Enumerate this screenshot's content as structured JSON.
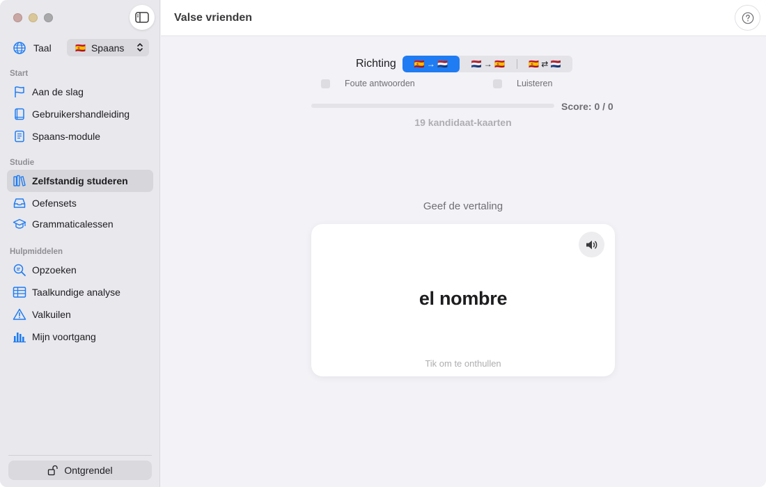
{
  "window": {
    "traffic_lights": [
      "close",
      "minimize",
      "zoom"
    ]
  },
  "sidebar": {
    "toggle_icon": "sidebar-toggle-icon",
    "language": {
      "label": "Taal",
      "icon": "globe-icon",
      "flag": "🇪🇸",
      "selected": "Spaans"
    },
    "sections": [
      {
        "title": "Start",
        "items": [
          {
            "label": "Aan de slag",
            "icon": "flag-icon"
          },
          {
            "label": "Gebruikershandleiding",
            "icon": "book-icon"
          },
          {
            "label": "Spaans-module",
            "icon": "document-icon"
          }
        ]
      },
      {
        "title": "Studie",
        "items": [
          {
            "label": "Zelfstandig studeren",
            "icon": "books-icon",
            "active": true
          },
          {
            "label": "Oefensets",
            "icon": "tray-icon"
          },
          {
            "label": "Grammaticalessen",
            "icon": "graduation-cap-icon"
          }
        ]
      },
      {
        "title": "Hulpmiddelen",
        "items": [
          {
            "label": "Opzoeken",
            "icon": "magnifier-icon"
          },
          {
            "label": "Taalkundige analyse",
            "icon": "table-icon"
          },
          {
            "label": "Valkuilen",
            "icon": "warning-icon"
          },
          {
            "label": "Mijn voortgang",
            "icon": "bar-chart-icon"
          }
        ]
      }
    ],
    "unlock_label": "Ontgrendel"
  },
  "header": {
    "title": "Valse vrienden",
    "help_icon": "question-mark-icon"
  },
  "controls": {
    "direction_label": "Richting",
    "direction_options": [
      "🇪🇸 → 🇳🇱",
      "🇳🇱 → 🇪🇸",
      "🇪🇸 ⇄ 🇳🇱"
    ],
    "direction_selected": 0,
    "wrong_answers_label": "Foute antwoorden",
    "wrong_answers_checked": false,
    "listen_label": "Luisteren",
    "listen_checked": false,
    "progress": 0,
    "score": "Score: 0 / 0",
    "candidates": "19 kandidaat-kaarten"
  },
  "card": {
    "prompt": "Geef de vertaling",
    "word": "el nombre",
    "hint": "Tik om te onthullen",
    "speaker_icon": "speaker-icon"
  },
  "colors": {
    "accent": "#1f7cf2",
    "sidebar_bg": "#e8e8ed",
    "content_bg": "#f2f2f7"
  }
}
